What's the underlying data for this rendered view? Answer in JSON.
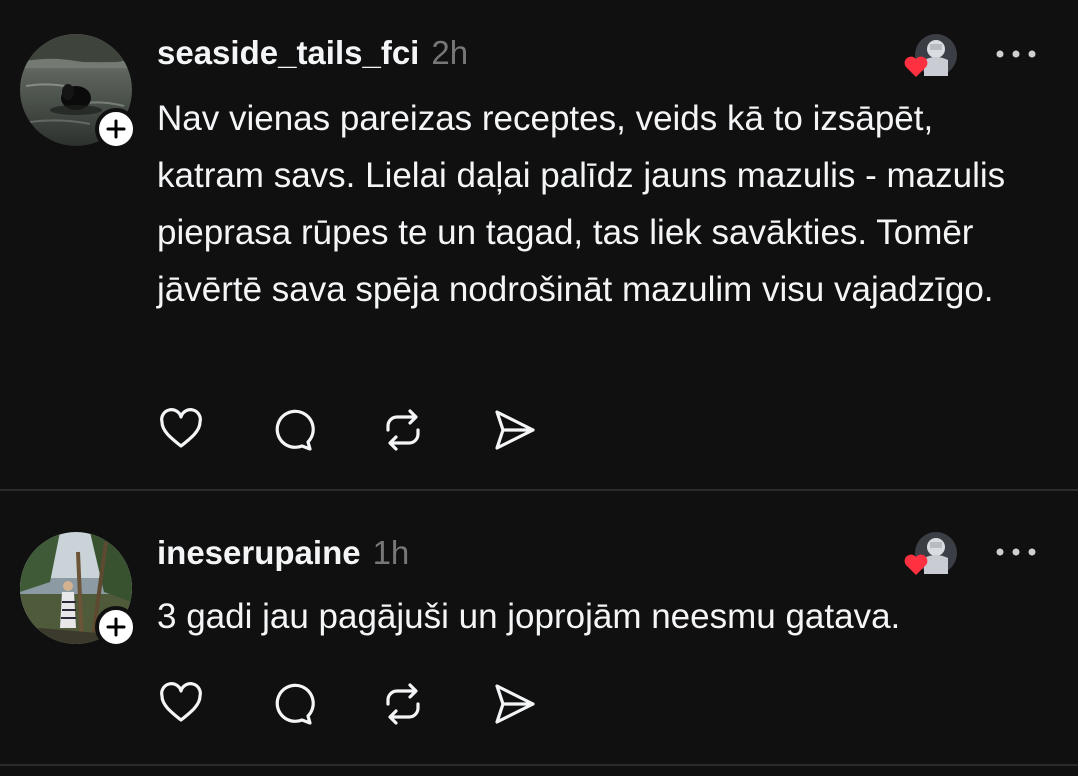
{
  "posts": [
    {
      "username": "seaside_tails_fci",
      "time": "2h",
      "text": "Nav vienas pareizas receptes, veids kā to izsāpēt, katram savs. Lielai daļai palīdz jauns mazulis - mazulis pieprasa rūpes te un tagad, tas liek savākties. Tomēr jāvērtē sava spēja nodrošināt mazulim visu vajadzīgo.",
      "avatar_icon": "dog-swimming-photo",
      "actions": [
        "heart-icon",
        "comment-icon",
        "repost-icon",
        "share-icon"
      ]
    },
    {
      "username": "ineserupaine",
      "time": "1h",
      "text": "3 gadi jau pagājuši un joprojām neesmu gatava.",
      "avatar_icon": "woman-by-lake-photo",
      "actions": [
        "heart-icon",
        "comment-icon",
        "repost-icon",
        "share-icon"
      ]
    }
  ],
  "colors": {
    "background": "#101010",
    "text": "#f3f5f7",
    "secondary": "#777777",
    "divider": "#2b2b2b",
    "like_heart": "#ff3040"
  }
}
